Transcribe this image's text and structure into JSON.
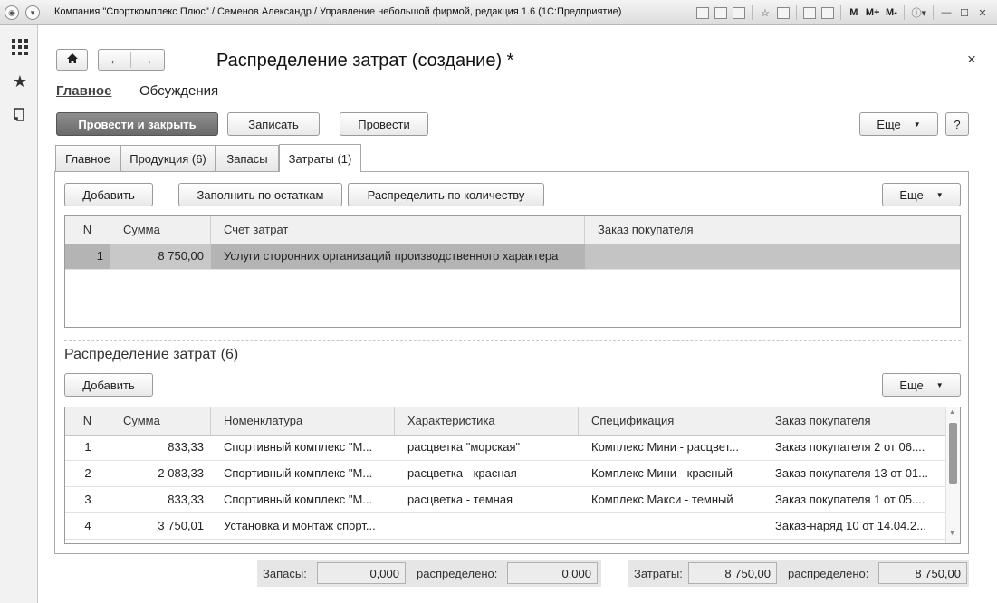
{
  "window": {
    "title": "Компания \"Спорткомплекс Плюс\" / Семенов Александр / Управление небольшой фирмой, редакция 1.6  (1С:Предприятие)",
    "buttons": {
      "m": "M",
      "mplus": "M+",
      "mminus": "M-"
    }
  },
  "document": {
    "title": "Распределение затрат (создание) *",
    "nav_links": [
      "Главное",
      "Обсуждения"
    ],
    "close_glyph": "×"
  },
  "toolbar": {
    "post_close": "Провести и закрыть",
    "save": "Записать",
    "post": "Провести",
    "more": "Еще",
    "help": "?"
  },
  "tabs": [
    "Главное",
    "Продукция (6)",
    "Запасы",
    "Затраты (1)"
  ],
  "active_tab": "Затраты (1)",
  "costs": {
    "toolbar": {
      "add": "Добавить",
      "fill": "Заполнить по остаткам",
      "distribute": "Распределить по количеству",
      "more": "Еще"
    },
    "columns": [
      "N",
      "Сумма",
      "Счет затрат",
      "Заказ покупателя"
    ],
    "rows": [
      {
        "n": "1",
        "sum": "8 750,00",
        "account": "Услуги сторонних организаций производственного характера",
        "order": ""
      }
    ]
  },
  "distribution": {
    "title": "Распределение затрат (6)",
    "toolbar": {
      "add": "Добавить",
      "more": "Еще"
    },
    "columns": [
      "N",
      "Сумма",
      "Номенклатура",
      "Характеристика",
      "Спецификация",
      "Заказ покупателя"
    ],
    "rows": [
      {
        "n": "1",
        "sum": "833,33",
        "item": "Спортивный комплекс \"М...",
        "char": "расцветка \"морская\"",
        "spec": "Комплекс Мини - расцвет...",
        "order": "Заказ покупателя 2 от 06...."
      },
      {
        "n": "2",
        "sum": "2 083,33",
        "item": "Спортивный комплекс \"М...",
        "char": "расцветка - красная",
        "spec": "Комплекс Мини - красный",
        "order": "Заказ покупателя 13 от 01..."
      },
      {
        "n": "3",
        "sum": "833,33",
        "item": "Спортивный комплекс \"М...",
        "char": "расцветка - темная",
        "spec": "Комплекс Макси - темный",
        "order": "Заказ покупателя 1 от 05...."
      },
      {
        "n": "4",
        "sum": "3 750,01",
        "item": "Установка и монтаж спорт...",
        "char": "",
        "spec": "",
        "order": "Заказ-наряд 10 от 14.04.2..."
      }
    ]
  },
  "totals": {
    "stock_label": "Запасы:",
    "stock_value": "0,000",
    "stock_dist_label": "распределено:",
    "stock_dist_value": "0,000",
    "costs_label": "Затраты:",
    "costs_value": "8 750,00",
    "costs_dist_label": "распределено:",
    "costs_dist_value": "8 750,00"
  }
}
